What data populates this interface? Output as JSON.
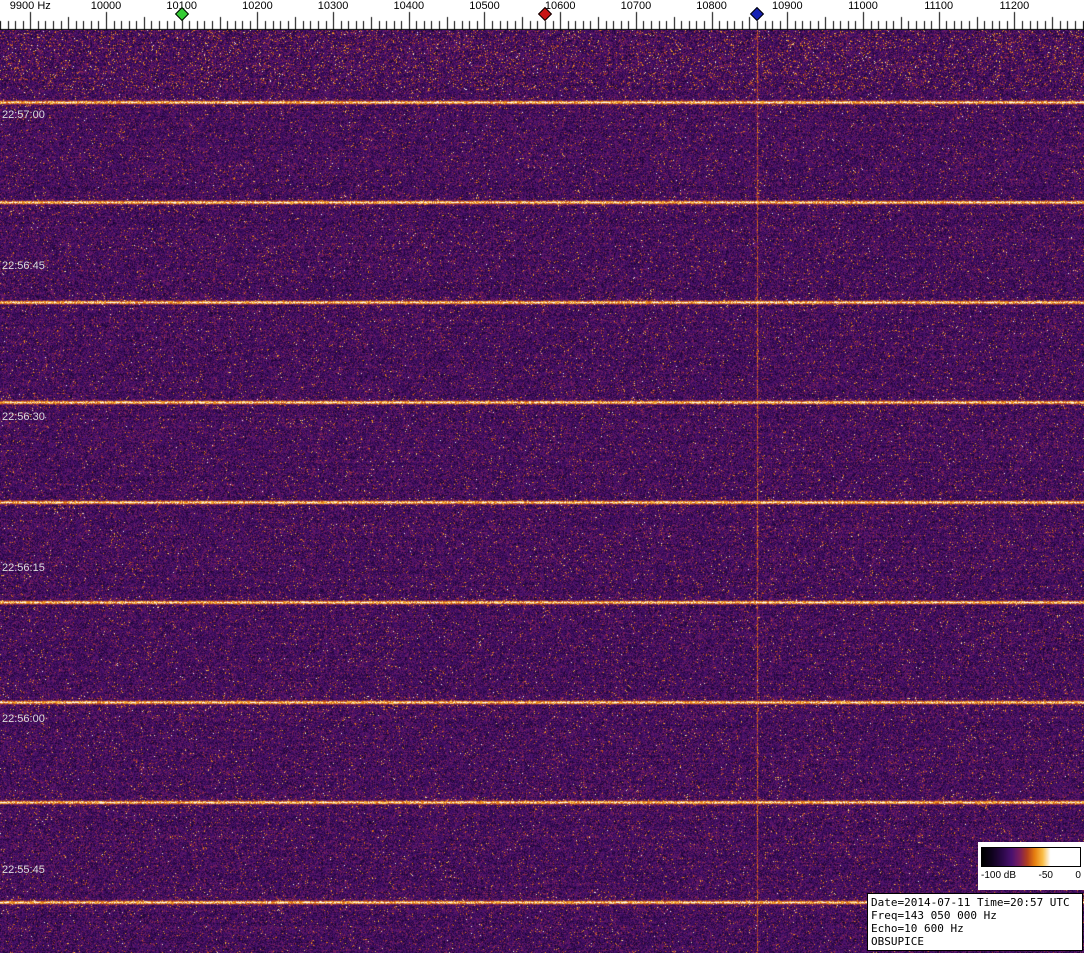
{
  "chart_data": {
    "type": "heatmap",
    "subtype": "spectrogram-waterfall",
    "x_axis": {
      "unit": "Hz",
      "tick_labels": [
        "9900 Hz",
        "10000",
        "10100",
        "10200",
        "10300",
        "10400",
        "10500",
        "10600",
        "10700",
        "10800",
        "10900",
        "11000",
        "11100",
        "11200"
      ],
      "tick_values_hz": [
        9900,
        10000,
        10100,
        10200,
        10300,
        10400,
        10500,
        10600,
        10700,
        10800,
        10900,
        11000,
        11100,
        11200
      ],
      "minor_tick_step_hz": 10
    },
    "y_axis": {
      "tick_labels": [
        "22:57:00",
        "22:56:45",
        "22:56:30",
        "22:56:15",
        "22:56:00",
        "22:55:45"
      ],
      "tick_interval_sec": 15,
      "direction": "newest-at-top"
    },
    "markers": [
      {
        "name": "green-diamond-marker",
        "freq_hz": 10100,
        "color": "#35cc35"
      },
      {
        "name": "red-diamond-marker",
        "freq_hz": 10580,
        "color": "#c81414"
      },
      {
        "name": "blue-diamond-marker",
        "freq_hz": 10860,
        "color": "#1420b4"
      }
    ],
    "vertical_trace_freq_hz": 10860,
    "bright_line_period_sec": 10,
    "colorbar": {
      "labels": [
        "-100 dB",
        "-50",
        "0"
      ],
      "min_db": -100,
      "max_db": 0
    },
    "palette": {
      "background_noise": "#44106a",
      "noise_dark": "#1c0636",
      "speckle_orange": "#c06018",
      "line_orange": "#ffb030",
      "line_core": "#ffffff",
      "scale_background": "#ffffff"
    }
  },
  "info_box": {
    "lines": [
      "Date=2014-07-11 Time=20:57 UTC",
      "Freq=143 050 000 Hz",
      "Echo=10 600 Hz",
      "OBSUPICE"
    ]
  }
}
